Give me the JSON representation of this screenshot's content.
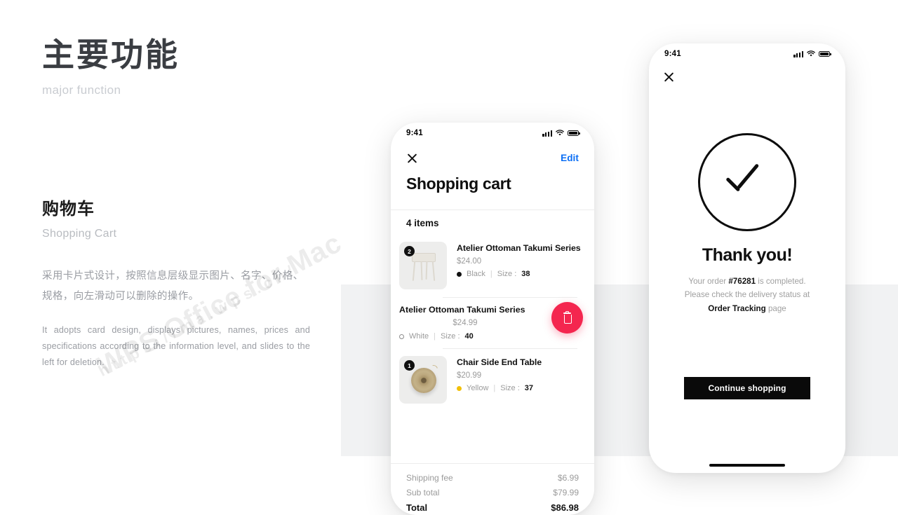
{
  "left": {
    "heading_zh": "主要功能",
    "heading_en": "major function",
    "section_zh": "购物车",
    "section_en": "Shopping Cart",
    "body_zh": "采用卡片式设计，按照信息层级显示图片、名字、价格、规格，向左滑动可以删除的操作。",
    "body_en": "It adopts card design, displays pictures, names, prices and specifications according to the information level, and slides to the left for deletion."
  },
  "watermark": {
    "line1": "WPS Office for Mac",
    "line2": "https://ma.wps.cn/"
  },
  "phone_cart": {
    "status": {
      "time": "9:41",
      "signal_icon": "signal-bars-icon",
      "wifi_icon": "wifi-icon",
      "battery_icon": "battery-full-icon"
    },
    "nav": {
      "close_icon": "close-icon",
      "edit_label": "Edit"
    },
    "title": "Shopping cart",
    "items_count": "4 items",
    "items": [
      {
        "qty": "2",
        "name": "Atelier Ottoman Takumi Series",
        "price": "$24.00",
        "color": "Black",
        "color_hex": "#111111",
        "color_style": "filled",
        "size_label": "Size :",
        "size": "38",
        "swiped": false,
        "thumb_icon": "stool-product-image"
      },
      {
        "qty": "",
        "name": "Atelier Ottoman Takumi Series",
        "price": "$24.99",
        "color": "White",
        "color_hex": "#ffffff",
        "color_style": "hollow",
        "size_label": "Size :",
        "size": "40",
        "swiped": true,
        "delete_icon": "trash-icon",
        "thumb_icon": ""
      },
      {
        "qty": "1",
        "name": "Chair Side End Table",
        "price": "$20.99",
        "color": "Yellow",
        "color_hex": "#f2c008",
        "color_style": "filled",
        "size_label": "Size :",
        "size": "37",
        "swiped": false,
        "thumb_icon": "twine-ball-product-image"
      }
    ],
    "totals": [
      {
        "label": "Shipping fee",
        "value": "$6.99",
        "grand": false
      },
      {
        "label": "Sub total",
        "value": "$79.99",
        "grand": false
      },
      {
        "label": "Total",
        "value": "$86.98",
        "grand": true
      }
    ]
  },
  "phone_thanks": {
    "status": {
      "time": "9:41",
      "signal_icon": "signal-bars-icon",
      "wifi_icon": "wifi-icon",
      "battery_icon": "battery-full-icon"
    },
    "close_icon": "close-icon",
    "check_icon": "check-circle-icon",
    "title": "Thank you!",
    "body_prefix": "Your order ",
    "order_id": "#76281",
    "body_mid": " is completed.",
    "body_line2": "Please check the delivery status at",
    "link_text": "Order Tracking",
    "body_suffix": " page",
    "cta_label": "Continue shopping"
  },
  "colors": {
    "accent_blue": "#0a6ef5",
    "delete_red": "#f4264f",
    "panel_gray": "#f1f2f3",
    "black": "#0a0a0a"
  }
}
